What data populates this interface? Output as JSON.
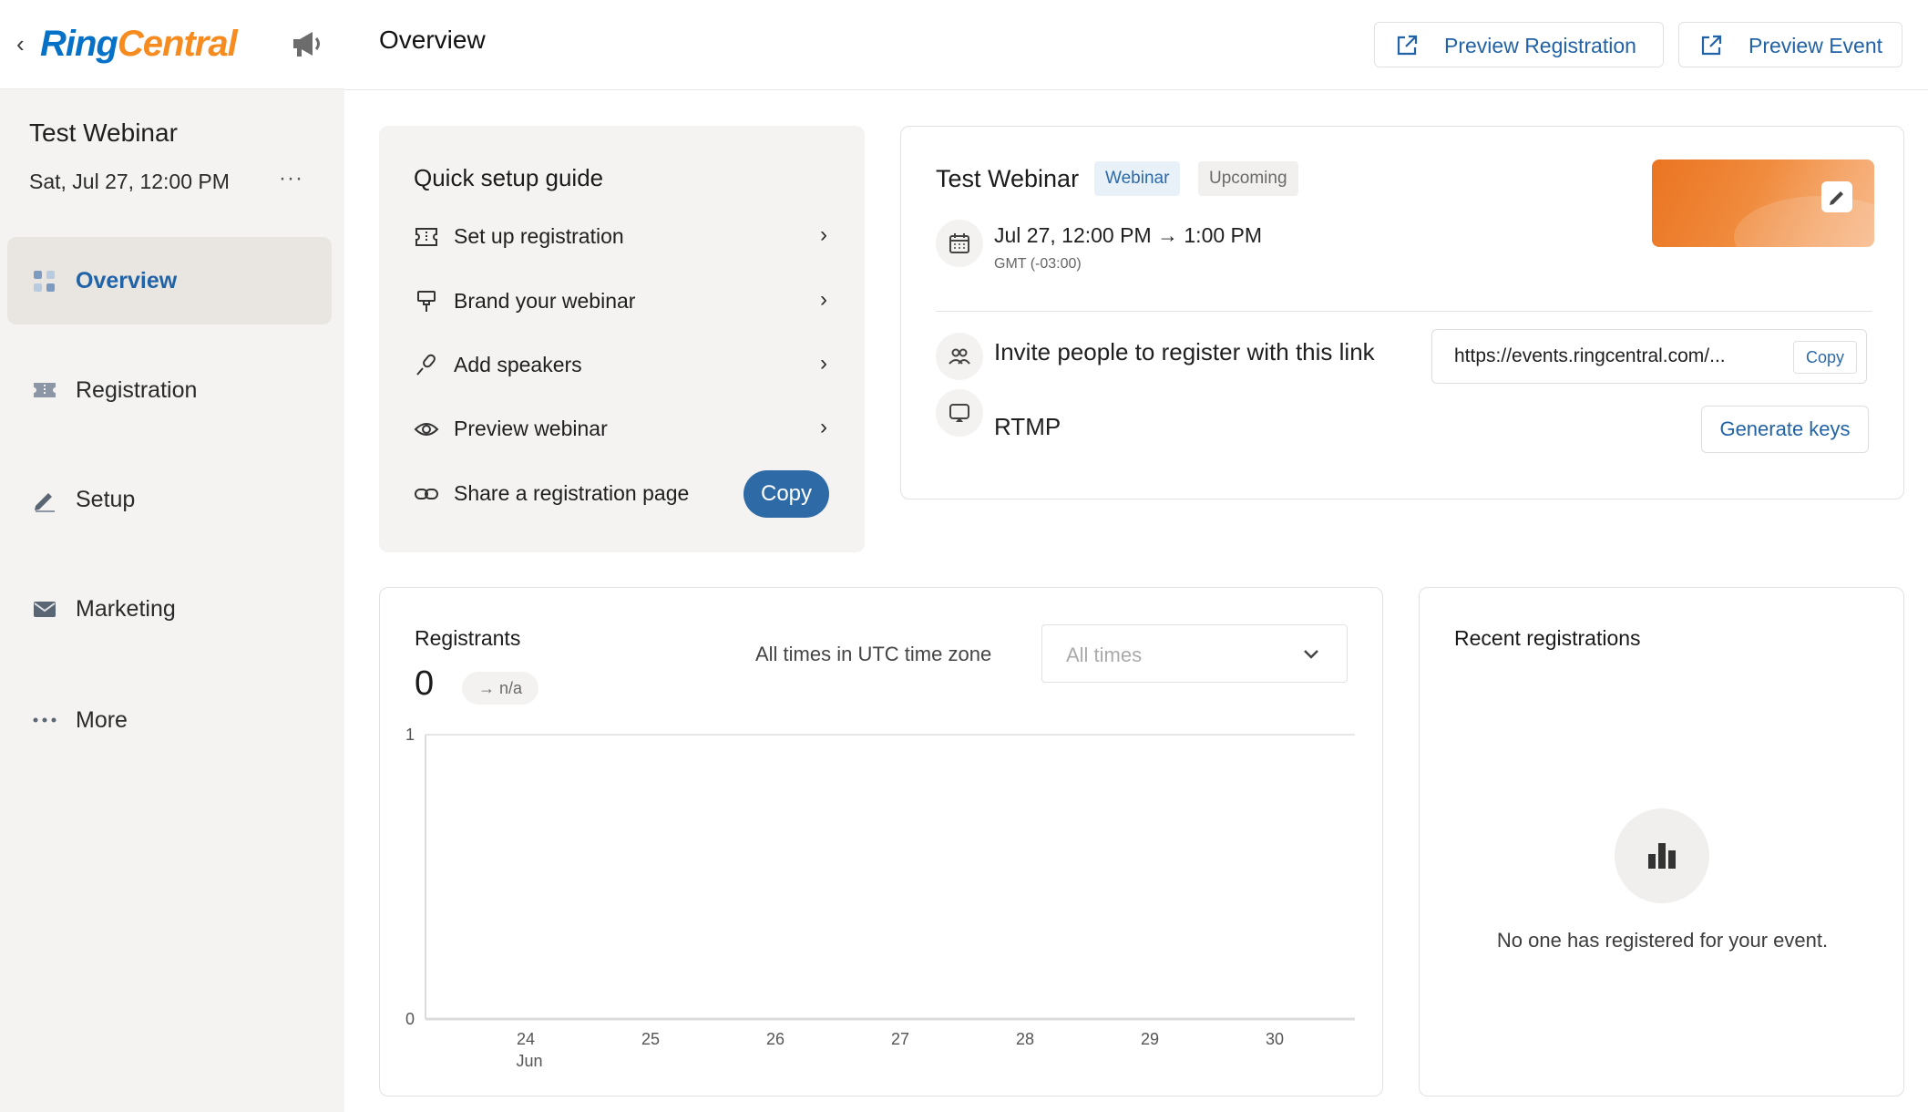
{
  "brand": {
    "part1": "Ring",
    "part2": "Central",
    "color_blue": "#0672c7",
    "color_orange": "#f68b1f"
  },
  "sidebar": {
    "event_title": "Test Webinar",
    "event_date": "Sat, Jul 27, 12:00 PM",
    "more_glyph": "···",
    "items": [
      {
        "label": "Overview",
        "icon": "grid-icon",
        "active": true
      },
      {
        "label": "Registration",
        "icon": "ticket-icon",
        "active": false
      },
      {
        "label": "Setup",
        "icon": "pencil-icon",
        "active": false
      },
      {
        "label": "Marketing",
        "icon": "mail-icon",
        "active": false
      },
      {
        "label": "More",
        "icon": "more-dots-icon",
        "active": false
      }
    ]
  },
  "header": {
    "title": "Overview",
    "preview_registration": "Preview Registration",
    "preview_event": "Preview Event"
  },
  "quick_setup": {
    "title": "Quick setup guide",
    "items": [
      {
        "label": "Set up registration",
        "icon": "ticket-icon"
      },
      {
        "label": "Brand your webinar",
        "icon": "paint-brush-icon"
      },
      {
        "label": "Add speakers",
        "icon": "microphone-icon"
      },
      {
        "label": "Preview webinar",
        "icon": "eye-icon"
      },
      {
        "label": "Share a registration page",
        "icon": "link-icon"
      }
    ],
    "copy_label": "Copy"
  },
  "event": {
    "name": "Test Webinar",
    "type_tag": "Webinar",
    "status_tag": "Upcoming",
    "time_range": "Jul 27, 12:00 PM → 1:00 PM",
    "timezone": "GMT (-03:00)",
    "invite_label": "Invite people to register with this link",
    "invite_url": "https://events.ringcentral.com/...",
    "invite_copy": "Copy",
    "rtmp_label": "RTMP",
    "generate_keys": "Generate keys"
  },
  "registrants": {
    "title": "Registrants",
    "count": "0",
    "delta": "→ n/a",
    "timezone_note": "All times in UTC time zone",
    "range_select": "All times"
  },
  "chart_data": {
    "type": "line",
    "x": [
      "24",
      "25",
      "26",
      "27",
      "28",
      "29",
      "30"
    ],
    "x_sublabel": "Jun",
    "series": [],
    "ylim": [
      0,
      1
    ],
    "yticks": [
      "0",
      "1"
    ],
    "grid": false
  },
  "recent": {
    "title": "Recent registrations",
    "empty_text": "No one has registered for your event."
  },
  "colors": {
    "accent": "#2163a6",
    "button": "#2d6aa6",
    "sidebar_bg": "#f4f3f1"
  }
}
